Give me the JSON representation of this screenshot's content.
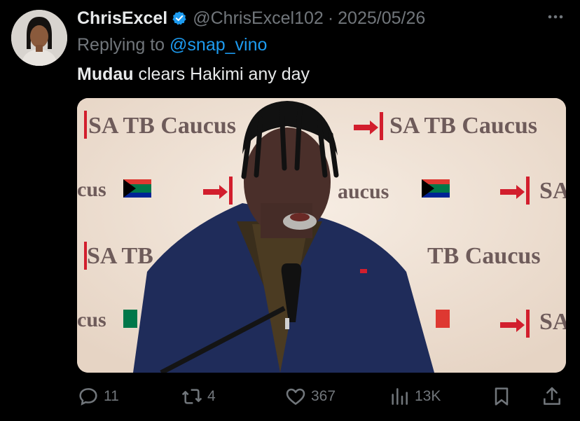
{
  "author": {
    "name": "ChrisExcel",
    "handle": "@ChrisExcel102",
    "separator": "·",
    "date": "2025/05/26",
    "verified_icon": "verified-badge-icon",
    "more_icon": "more-options-icon"
  },
  "reply": {
    "prefix": "Replying to ",
    "mention": "@snap_vino"
  },
  "tweet": {
    "bold_word": "Mudau",
    "rest": " clears Hakimi any day"
  },
  "media": {
    "backdrop_texts": [
      "SA TB Caucus",
      "SA TB Caucus",
      "aucus",
      "cus",
      "SA TB",
      "TB Caucus",
      "cus",
      "SA",
      "SA"
    ],
    "colors": {
      "backdrop": "#efe2d6",
      "logo_red": "#d21e2d",
      "jacket": "#1f2c5a"
    }
  },
  "actions": {
    "reply_count": "11",
    "retweet_count": "4",
    "like_count": "367",
    "views_count": "13K",
    "icons": [
      "reply-icon",
      "retweet-icon",
      "like-icon",
      "views-icon",
      "bookmark-icon",
      "share-icon"
    ]
  },
  "colors": {
    "accent": "#1d9bf0",
    "muted": "#71767b",
    "text": "#e7e9ea",
    "background": "#000000"
  }
}
